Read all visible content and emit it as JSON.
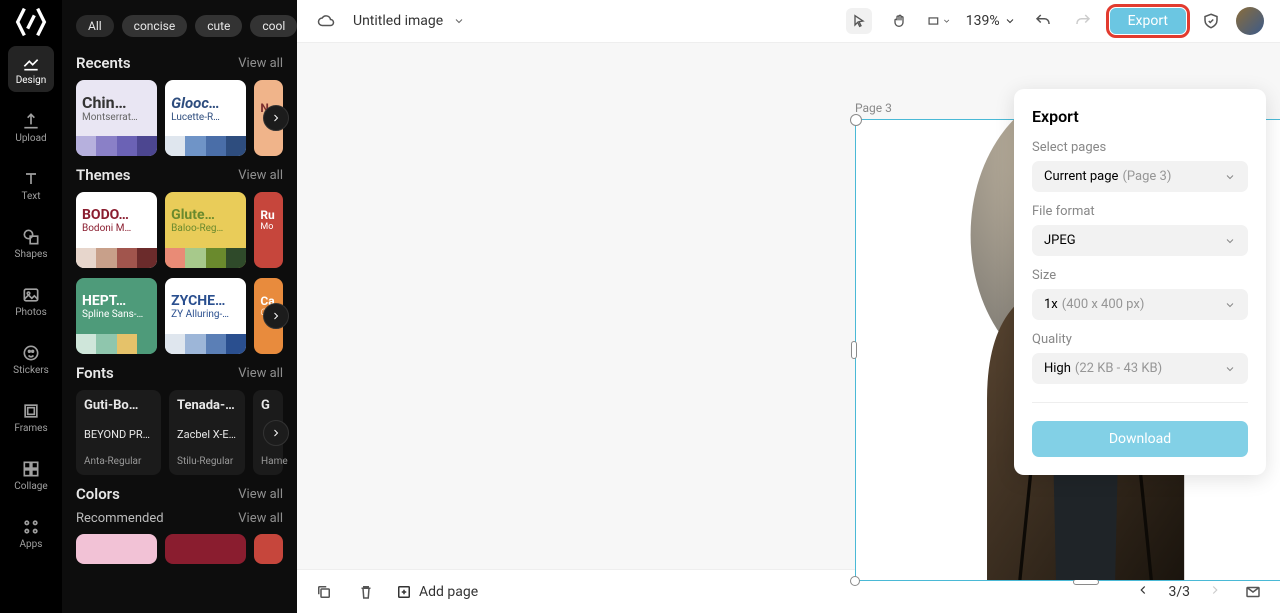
{
  "nav": {
    "items": [
      {
        "key": "design",
        "label": "Design"
      },
      {
        "key": "upload",
        "label": "Upload"
      },
      {
        "key": "text",
        "label": "Text"
      },
      {
        "key": "shapes",
        "label": "Shapes"
      },
      {
        "key": "photos",
        "label": "Photos"
      },
      {
        "key": "stickers",
        "label": "Stickers"
      },
      {
        "key": "frames",
        "label": "Frames"
      },
      {
        "key": "collage",
        "label": "Collage"
      },
      {
        "key": "apps",
        "label": "Apps"
      }
    ]
  },
  "panel": {
    "chips": [
      "All",
      "concise",
      "cute",
      "cool"
    ],
    "recents_title": "Recents",
    "themes_title": "Themes",
    "fonts_title": "Fonts",
    "colors_title": "Colors",
    "recommended": "Recommended",
    "view_all": "View all",
    "recents": [
      {
        "t1": "Chin…",
        "t2": "Montserrat…",
        "bg": "#e9e6f3",
        "c1": "#b6b0dd",
        "c2": "#8a80c7",
        "c3": "#6b62b5",
        "c4": "#4c4690"
      },
      {
        "t1": "Glooc…",
        "t2": "Lucette-R…",
        "bg": "#ffffff",
        "c1": "#dfe6ee",
        "c2": "#6f94c7",
        "c3": "#4a6ea8",
        "c4": "#2e4d7e",
        "tc": "#2e4d7e"
      },
      {
        "t1": "N",
        "t2": "",
        "bg": "#f0b48a"
      }
    ],
    "themes": [
      {
        "t1": "BODO…",
        "t2": "Bodoni M…",
        "bg": "#ffffff",
        "tc": "#8a1d2f",
        "c1": "#e7d6cc",
        "c2": "#c8a08a",
        "c3": "#a1554d",
        "c4": "#6b2b2b"
      },
      {
        "t1": "Glute…",
        "t2": "Baloo-Reg…",
        "bg": "#e9cc59",
        "tc": "#6a8a2d",
        "c1": "#e98b76",
        "c2": "#a7c98b",
        "c3": "#6a8a2d",
        "c4": "#2f4a2a"
      },
      {
        "t1": "Ru",
        "t2": "Mo",
        "bg": "#c6463c"
      },
      {
        "t1": "HEPT…",
        "t2": "Spline Sans-…",
        "bg": "#4e9b7a",
        "tc": "#ffffff",
        "c1": "#cfe6da",
        "c2": "#8fc6ad",
        "c3": "#e5c26a",
        "c4": "#4e9b7a"
      },
      {
        "t1": "ZYCHE…",
        "t2": "ZY Alluring-…",
        "bg": "#ffffff",
        "tc": "#2a4f8f",
        "c1": "#dfe6ee",
        "c2": "#9db6d8",
        "c3": "#5b7fb6",
        "c4": "#2a4f8f"
      },
      {
        "t1": "Ca",
        "t2": "Cle",
        "bg": "#e88b3d"
      }
    ],
    "fonts": [
      {
        "f1": "Guti-Bo…",
        "f2": "BEYOND PRO…",
        "f3": "Anta-Regular"
      },
      {
        "f1": "Tenada-…",
        "f2": "Zacbel X-E…",
        "f3": "Stilu-Regular"
      },
      {
        "f1": "G",
        "f2": "",
        "f3": "Hame"
      }
    ]
  },
  "topbar": {
    "title": "Untitled image",
    "zoom": "139%",
    "export": "Export"
  },
  "canvas": {
    "page_label": "Page 3"
  },
  "export": {
    "title": "Export",
    "select_pages_label": "Select pages",
    "select_pages_value": "Current page",
    "select_pages_hint": "(Page 3)",
    "format_label": "File format",
    "format_value": "JPEG",
    "size_label": "Size",
    "size_value": "1x",
    "size_hint": "(400 x 400 px)",
    "quality_label": "Quality",
    "quality_value": "High",
    "quality_hint": "(22 KB - 43 KB)",
    "download": "Download"
  },
  "bottombar": {
    "add_page": "Add page",
    "page_indicator": "3/3"
  }
}
